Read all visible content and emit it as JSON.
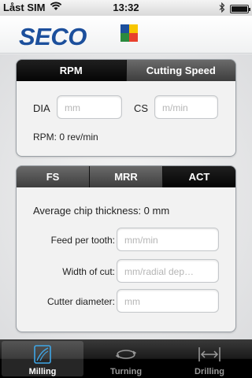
{
  "status_bar": {
    "carrier": "Låst SIM",
    "time": "13:32"
  },
  "header": {
    "logo_text": "SECO",
    "logo_colors": [
      "#f7c600",
      "#e8402d",
      "#2b8a3e",
      "#1c4f9c"
    ]
  },
  "rpm_panel": {
    "tabs": [
      {
        "label": "RPM",
        "selected": true
      },
      {
        "label": "Cutting Speed",
        "selected": false
      }
    ],
    "dia_label": "DIA",
    "dia_placeholder": "mm",
    "cs_label": "CS",
    "cs_placeholder": "m/min",
    "result": "RPM:  0 rev/min"
  },
  "chip_panel": {
    "tabs": [
      {
        "label": "FS",
        "selected": false
      },
      {
        "label": "MRR",
        "selected": false
      },
      {
        "label": "ACT",
        "selected": true
      }
    ],
    "result": "Average chip thickness:  0 mm",
    "fields": [
      {
        "label": "Feed per tooth:",
        "placeholder": "mm/min"
      },
      {
        "label": "Width of cut:",
        "placeholder": "mm/radial dep…"
      },
      {
        "label": "Cutter diameter:",
        "placeholder": "mm"
      }
    ]
  },
  "tab_bar": {
    "items": [
      {
        "label": "Milling",
        "icon": "milling-icon",
        "selected": true
      },
      {
        "label": "Turning",
        "icon": "turning-icon",
        "selected": false
      },
      {
        "label": "Drilling",
        "icon": "drilling-icon",
        "selected": false
      }
    ]
  },
  "colors": {
    "accent": "#1c4f9c",
    "tab_active": "#3fa6e6"
  }
}
